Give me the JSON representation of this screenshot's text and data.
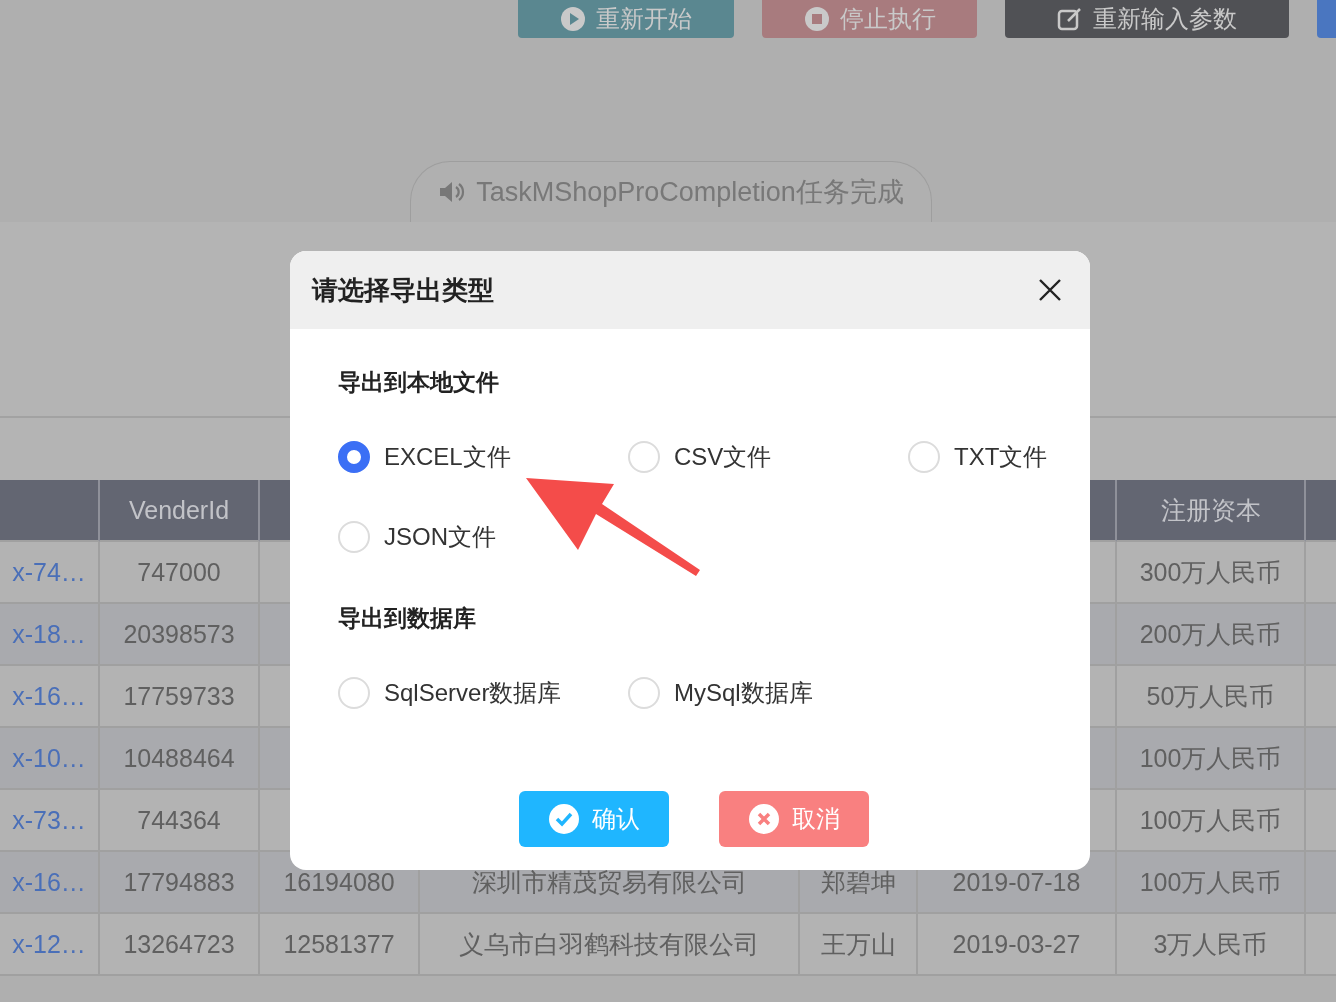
{
  "toolbar": {
    "buttons": [
      {
        "label": "重新开始",
        "kind": "restart"
      },
      {
        "label": "停止执行",
        "kind": "stop"
      },
      {
        "label": "重新输入参数",
        "kind": "edit"
      },
      {
        "kind": "partial"
      }
    ]
  },
  "notice": {
    "text": "TaskMShopProCompletion任务完成"
  },
  "table": {
    "columns": [
      null,
      "VenderId",
      null,
      null,
      null,
      null,
      "注册资本",
      null
    ],
    "rows": [
      {
        "cells": [
          "x-74…",
          "747000",
          null,
          null,
          null,
          null,
          "300万人民币"
        ]
      },
      {
        "cells": [
          "x-18…",
          "20398573",
          null,
          null,
          null,
          null,
          "200万人民币"
        ]
      },
      {
        "cells": [
          "x-16…",
          "17759733",
          null,
          null,
          null,
          null,
          "50万人民币"
        ]
      },
      {
        "cells": [
          "x-10…",
          "10488464",
          null,
          null,
          null,
          null,
          "100万人民币"
        ]
      },
      {
        "cells": [
          "x-73…",
          "744364",
          null,
          null,
          null,
          null,
          "100万人民币"
        ]
      },
      {
        "cells": [
          "x-16…",
          "17794883",
          "16194080",
          "深圳市精茂贸易有限公司",
          "郑碧坤",
          "2019-07-18",
          "100万人民币"
        ]
      },
      {
        "cells": [
          "x-12…",
          "13264723",
          "12581377",
          "义乌市白羽鹤科技有限公司",
          "王万山",
          "2019-03-27",
          "3万人民币"
        ]
      }
    ]
  },
  "dialog": {
    "title": "请选择导出类型",
    "sections": [
      {
        "heading": "导出到本地文件",
        "options": [
          {
            "label": "EXCEL文件",
            "selected": true
          },
          {
            "label": "CSV文件",
            "selected": false
          },
          {
            "label": "TXT文件",
            "selected": false
          },
          {
            "label": "JSON文件",
            "selected": false
          }
        ]
      },
      {
        "heading": "导出到数据库",
        "options": [
          {
            "label": "SqlServer数据库",
            "selected": false
          },
          {
            "label": "MySql数据库",
            "selected": false
          }
        ]
      }
    ],
    "buttons": [
      {
        "label": "确认",
        "kind": "confirm"
      },
      {
        "label": "取消",
        "kind": "cancel"
      }
    ]
  }
}
